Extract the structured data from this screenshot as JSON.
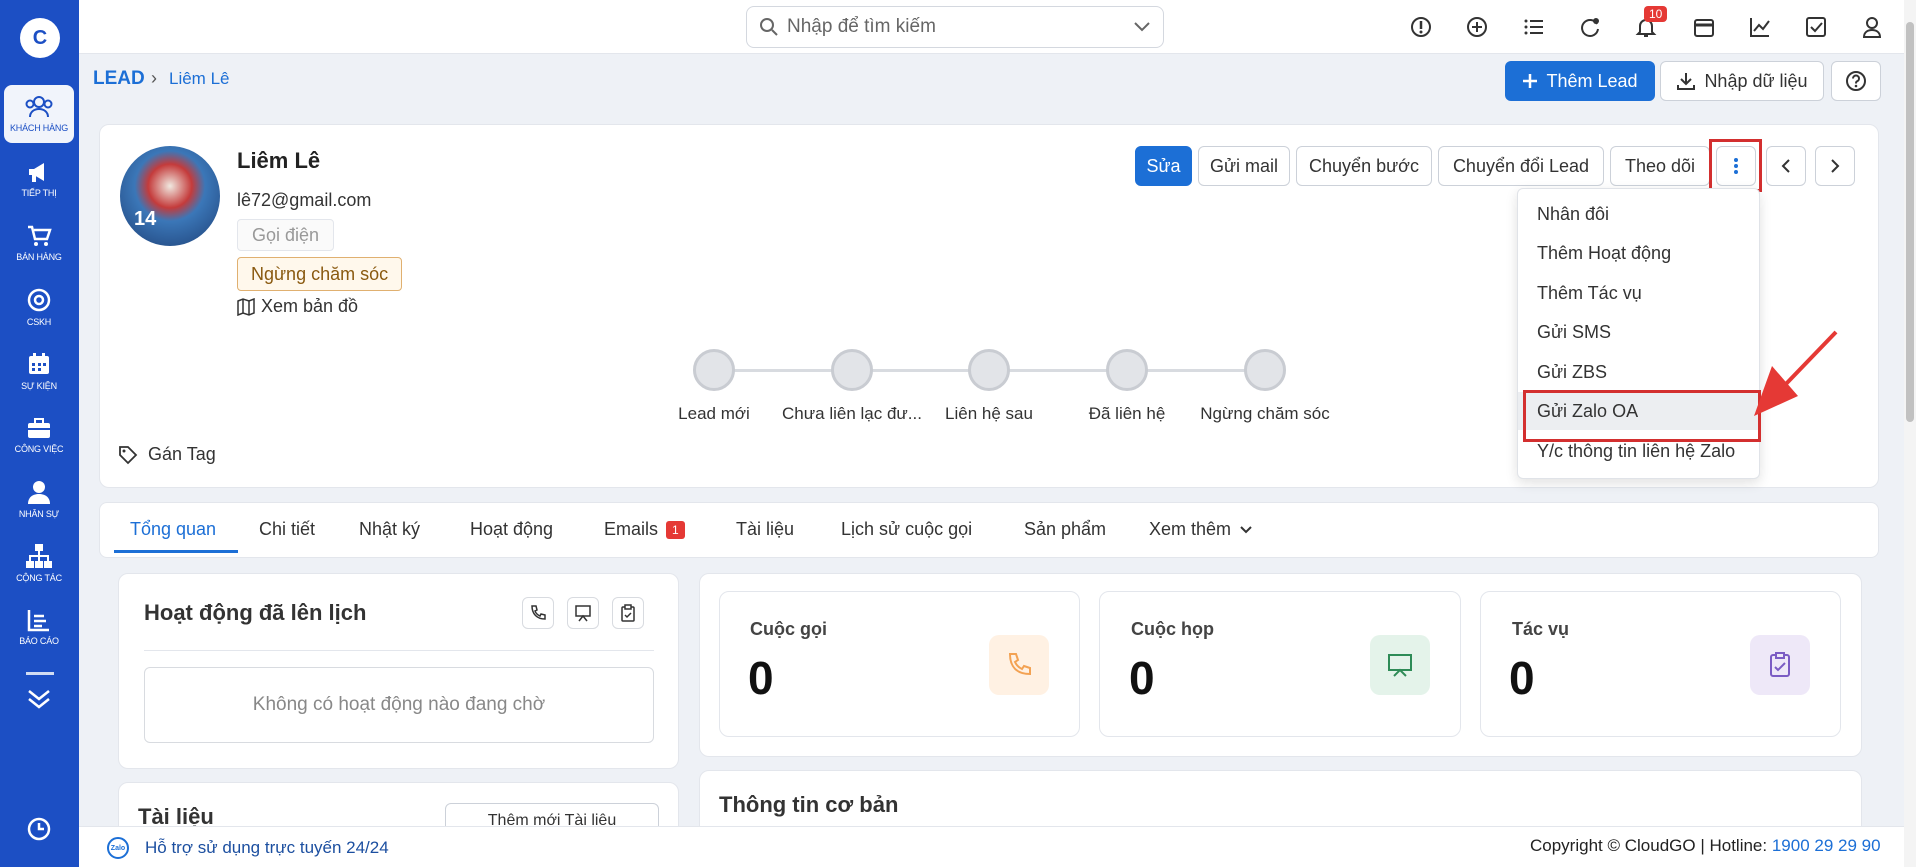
{
  "search": {
    "placeholder": "Nhập để tìm kiếm"
  },
  "notifications": {
    "count": "10"
  },
  "sidebar": {
    "logo": "C",
    "items": [
      {
        "label": "KHÁCH HÀNG",
        "icon": "users-icon"
      },
      {
        "label": "TIẾP THỊ",
        "icon": "megaphone-icon"
      },
      {
        "label": "BÁN HÀNG",
        "icon": "cart-icon"
      },
      {
        "label": "CSKH",
        "icon": "lifebuoy-icon"
      },
      {
        "label": "SỰ KIỆN",
        "icon": "calendar-icon"
      },
      {
        "label": "CÔNG VIỆC",
        "icon": "briefcase-icon"
      },
      {
        "label": "NHÂN SỰ",
        "icon": "person-icon"
      },
      {
        "label": "CỘNG TÁC",
        "icon": "network-icon"
      },
      {
        "label": "BÁO CÁO",
        "icon": "report-icon"
      }
    ]
  },
  "breadcrumb": {
    "root": "LEAD",
    "current": "Liêm Lê"
  },
  "header_actions": {
    "add_lead": "Thêm Lead",
    "import": "Nhập dữ liệu"
  },
  "profile": {
    "name": "Liêm Lê",
    "email": "lê72@gmail.com",
    "call_chip": "Gọi điện",
    "status_chip": "Ngừng chăm sóc",
    "map_link": "Xem bản đồ",
    "avatar_number": "14",
    "tag_label": "Gán Tag"
  },
  "actions": {
    "edit": "Sửa",
    "send_mail": "Gửi mail",
    "move_step": "Chuyển bước",
    "convert_lead": "Chuyển đổi Lead",
    "follow": "Theo dõi"
  },
  "steps": [
    "Lead mới",
    "Chưa liên lạc đư...",
    "Liên hệ sau",
    "Đã liên hệ",
    "Ngừng chăm sóc"
  ],
  "more_menu": {
    "items": [
      "Nhân đôi",
      "Thêm Hoạt động",
      "Thêm Tác vụ",
      "Gửi SMS",
      "Gửi ZBS",
      "Gửi Zalo OA",
      "Y/c thông tin liên hệ Zalo"
    ],
    "highlighted": "Gửi Zalo OA"
  },
  "tabs": [
    {
      "label": "Tổng quan"
    },
    {
      "label": "Chi tiết"
    },
    {
      "label": "Nhật ký"
    },
    {
      "label": "Hoạt động"
    },
    {
      "label": "Emails",
      "badge": "1"
    },
    {
      "label": "Tài liệu"
    },
    {
      "label": "Lịch sử cuộc gọi"
    },
    {
      "label": "Sản phẩm"
    },
    {
      "label": "Xem thêm"
    }
  ],
  "scheduled": {
    "title": "Hoạt động đã lên lịch",
    "empty_text": "Không có hoạt động nào đang chờ"
  },
  "documents": {
    "title": "Tài liệu",
    "add_button": "Thêm mới Tài liệu"
  },
  "stats": [
    {
      "label": "Cuộc gọi",
      "value": "0",
      "icon": "phone-icon",
      "color": "#f3a253"
    },
    {
      "label": "Cuộc họp",
      "value": "0",
      "icon": "presentation-icon",
      "color": "#2e8b57"
    },
    {
      "label": "Tác vụ",
      "value": "0",
      "icon": "clipboard-check-icon",
      "color": "#7b5cc4"
    }
  ],
  "basic_info": {
    "title": "Thông tin cơ bản"
  },
  "footer": {
    "support": "Hỗ trợ sử dụng trực tuyến 24/24",
    "copyright": "Copyright © CloudGO",
    "hotline_label": "Hotline:",
    "hotline_number": "1900 29 29 90"
  },
  "colors": {
    "primary": "#1c6fd6",
    "sidebar": "#1c4fc4",
    "highlight": "#d32f2f"
  }
}
